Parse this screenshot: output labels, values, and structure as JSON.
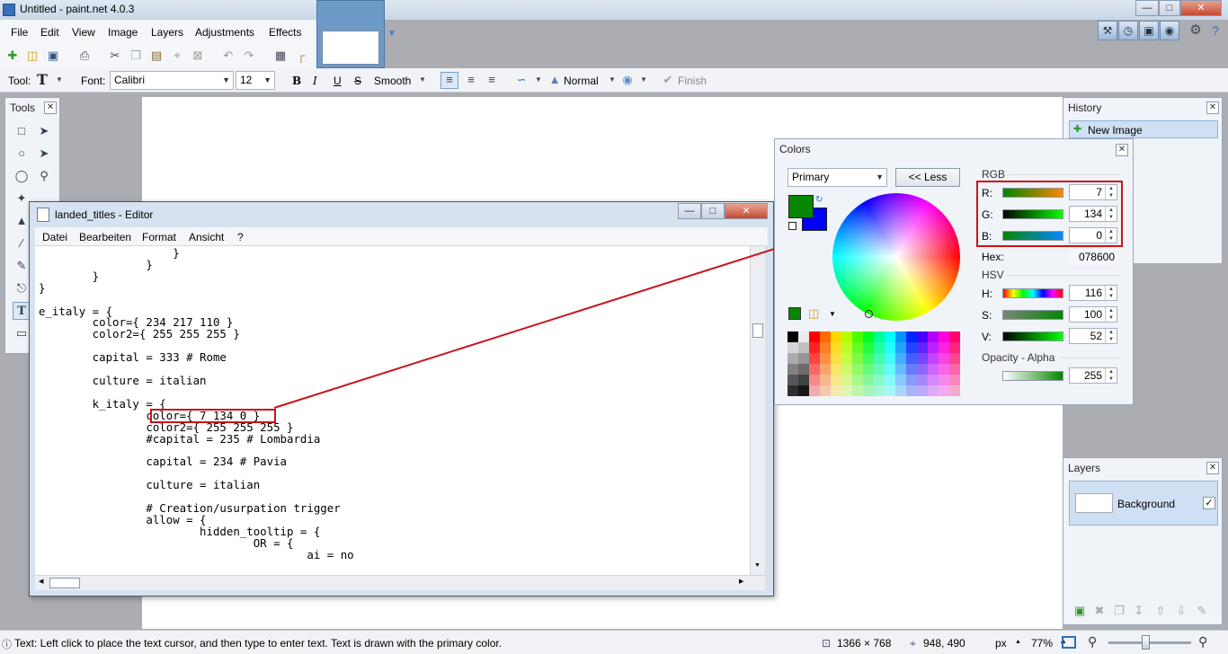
{
  "window": {
    "title": "Untitled - paint.net 4.0.3"
  },
  "menu": [
    "File",
    "Edit",
    "View",
    "Image",
    "Layers",
    "Adjustments",
    "Effects"
  ],
  "toolbar": {
    "tool_label": "Tool:",
    "font_label": "Font:",
    "font_value": "Calibri",
    "size_value": "12",
    "bold": "B",
    "italic": "I",
    "underline": "U",
    "strike": "S",
    "smooth": "Smooth",
    "blend_mode": "Normal",
    "finish": "Finish"
  },
  "tools_panel": {
    "title": "Tools"
  },
  "editor": {
    "title": "landed_titles - Editor",
    "menu": [
      "Datei",
      "Bearbeiten",
      "Format",
      "Ansicht",
      "?"
    ],
    "code": "                    }\n                }\n        }\n}\n\ne_italy = {\n        color={ 234 217 110 }\n        color2={ 255 255 255 }\n\n        capital = 333 # Rome\n\n        culture = italian\n\n        k_italy = {\n                color={ 7 134 0 }\n                color2={ 255 255 255 }\n                #capital = 235 # Lombardia\n\n                capital = 234 # Pavia\n\n                culture = italian\n\n                # Creation/usurpation trigger\n                allow = {\n                        hidden_tooltip = {\n                                OR = {\n                                        ai = no"
  },
  "colors_panel": {
    "title": "Colors",
    "primary_select": "Primary",
    "less_button": "<< Less",
    "rgb_section": "RGB",
    "r_label": "R:",
    "g_label": "G:",
    "b_label": "B:",
    "r_value": "7",
    "g_value": "134",
    "b_value": "0",
    "hex_label": "Hex:",
    "hex_value": "078600",
    "hsv_section": "HSV",
    "h_label": "H:",
    "s_label": "S:",
    "v_label": "V:",
    "h_value": "116",
    "s_value": "100",
    "v_value": "52",
    "alpha_section": "Opacity - Alpha",
    "alpha_value": "255",
    "primary_color": "#078600",
    "secondary_color": "#0000ff"
  },
  "history_panel": {
    "title": "History",
    "items": [
      "New Image"
    ]
  },
  "layers_panel": {
    "title": "Layers",
    "items": [
      "Background"
    ]
  },
  "statusbar": {
    "hint": "Text: Left click to place the text cursor, and then type to enter text. Text is drawn with the primary color.",
    "image_size": "1366 × 768",
    "cursor_pos": "948, 490",
    "units": "px",
    "zoom": "77%"
  }
}
